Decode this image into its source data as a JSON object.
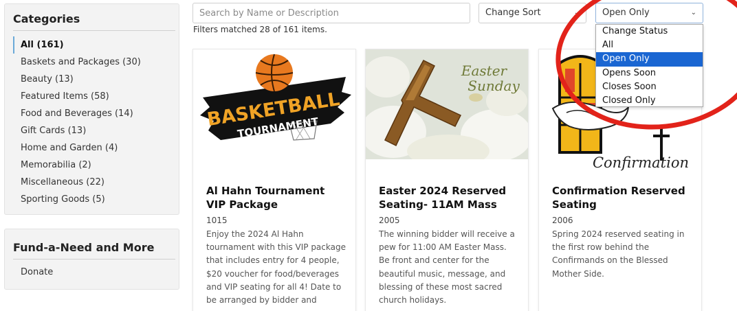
{
  "search": {
    "placeholder": "Search by Name or Description"
  },
  "sort": {
    "selected": "Change Sort"
  },
  "status": {
    "selected": "Open Only",
    "options": [
      "Change Status",
      "All",
      "Open Only",
      "Opens Soon",
      "Closes Soon",
      "Closed Only"
    ]
  },
  "filter_info": "Filters matched 28 of 161 items.",
  "categories": {
    "title": "Categories",
    "items": [
      "All (161)",
      "Baskets and Packages (30)",
      "Beauty (13)",
      "Featured Items (58)",
      "Food and Beverages (14)",
      "Gift Cards (13)",
      "Home and Garden (4)",
      "Memorabilia (2)",
      "Miscellaneous (22)",
      "Sporting Goods (5)"
    ]
  },
  "fund": {
    "title": "Fund-a-Need and More",
    "items": [
      "Donate"
    ]
  },
  "cards": [
    {
      "title": "Al Hahn Tournament VIP Package",
      "number": "1015",
      "description": "Enjoy the 2024 Al Hahn tournament with this VIP package that includes entry for 4 people, $20 voucher for food/beverages and VIP seating for all 4! Date to be arranged by bidder and",
      "image_text": [
        "BASKETBALL",
        "TOURNAMENT"
      ]
    },
    {
      "title": "Easter 2024 Reserved Seating- 11AM Mass",
      "number": "2005",
      "description": "The winning bidder will receive a pew for 11:00 AM Easter Mass. Be front and center for the beautiful music, message, and blessing of these most sacred church holidays.",
      "image_text": [
        "Easter",
        "Sunday"
      ]
    },
    {
      "title": "Confirmation Reserved Seating",
      "number": "2006",
      "description": "Spring 2024 reserved seating in the first row behind the Confirmands on the Blessed Mother Side.",
      "image_text": [
        "Confirmation"
      ]
    }
  ],
  "colors": {
    "selected_option": "#1a66d2",
    "annotation_ring": "#e2231a",
    "active_category_marker": "#6aa9d8"
  }
}
